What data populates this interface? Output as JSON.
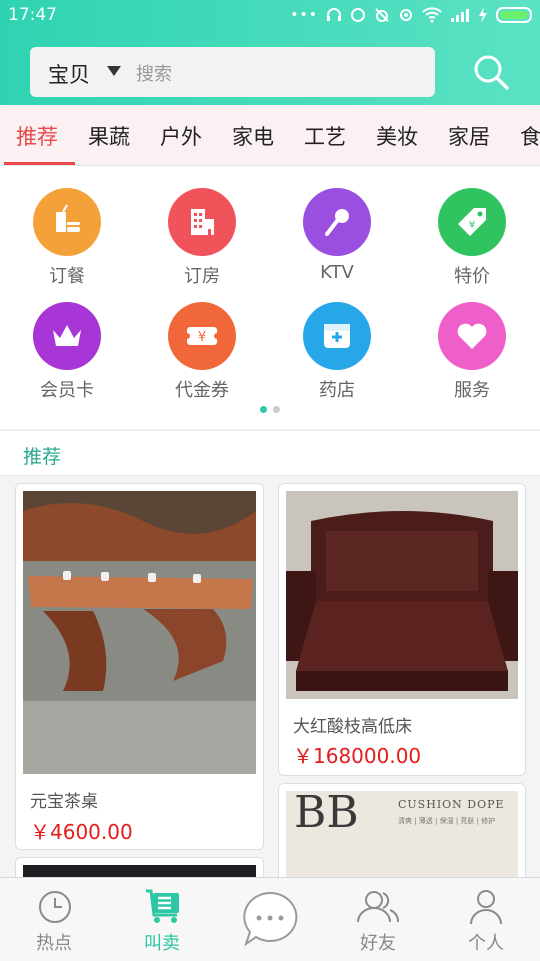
{
  "status_bar": {
    "time": "17:47"
  },
  "search": {
    "scope": "宝贝",
    "placeholder": "搜索"
  },
  "category_tabs": [
    "推荐",
    "果蔬",
    "户外",
    "家电",
    "工艺",
    "美妆",
    "家居",
    "食"
  ],
  "active_tab": "推荐",
  "quick_entries": [
    {
      "label": "订餐",
      "icon": "meal-icon",
      "color": "#f5a13a"
    },
    {
      "label": "订房",
      "icon": "hotel-icon",
      "color": "#f0545a"
    },
    {
      "label": "KTV",
      "icon": "microphone-icon",
      "color": "#9b4fe0"
    },
    {
      "label": "特价",
      "icon": "price-tag-icon",
      "color": "#2fc45f"
    },
    {
      "label": "会员卡",
      "icon": "crown-icon",
      "color": "#a835d6"
    },
    {
      "label": "代金券",
      "icon": "ticket-icon",
      "color": "#f0683a"
    },
    {
      "label": "药店",
      "icon": "pharmacy-icon",
      "color": "#27a7e8"
    },
    {
      "label": "服务",
      "icon": "heart-icon",
      "color": "#ee5fc9"
    }
  ],
  "pager": {
    "pages": 2,
    "current": 1
  },
  "section_title": "推荐",
  "products": [
    {
      "name": "元宝茶桌",
      "price": "￥4600.00"
    },
    {
      "name": "大红酸枝高低床",
      "price": "￥168000.00"
    },
    {
      "image_text": {
        "big": "BB",
        "brand": "CUSHION DOPE",
        "sub": "清爽 | 薄透 | 保湿 | 亮肤 | 修护"
      }
    }
  ],
  "bottom_nav": [
    {
      "label": "热点",
      "icon": "clock-icon"
    },
    {
      "label": "叫卖",
      "icon": "cart-list-icon"
    },
    {
      "label": "",
      "icon": "chat-bubble-icon"
    },
    {
      "label": "好友",
      "icon": "friends-icon"
    },
    {
      "label": "个人",
      "icon": "person-icon"
    }
  ],
  "colors": {
    "accent": "#2dc7a6",
    "header_start": "#2fd3b1",
    "header_end": "#5be2c4",
    "price": "#e51c1c",
    "active_tab": "#e84949"
  }
}
